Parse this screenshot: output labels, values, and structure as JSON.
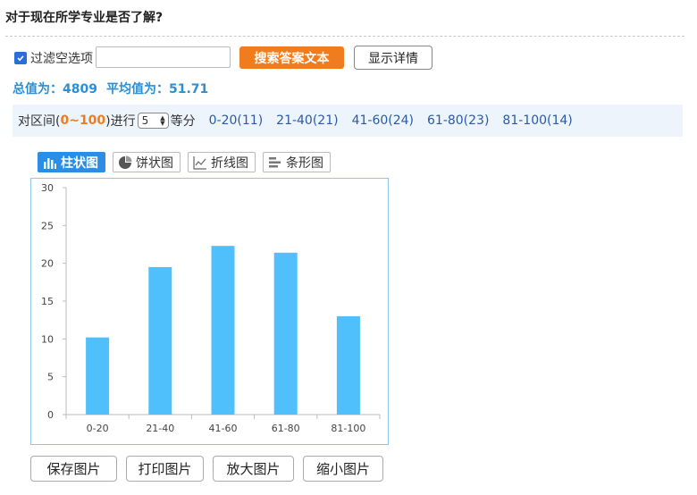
{
  "question": "对于现在所学专业是否了解?",
  "filter": {
    "checked": true,
    "label": "过滤空选项",
    "input_value": "",
    "search_button": "搜索答案文本",
    "detail_button": "显示详情"
  },
  "stats": {
    "total": "总值为：4809",
    "average": "平均值为：51.71"
  },
  "range": {
    "prefix": "对区间(",
    "range_text": "0~100",
    "suffix": ")进行",
    "select_value": "5",
    "after": "等分",
    "links": [
      "0-20(11)",
      "21-40(21)",
      "41-60(24)",
      "61-80(23)",
      "81-100(14)"
    ]
  },
  "chart_tabs": [
    {
      "label": "柱状图",
      "icon": "bar-chart-icon",
      "active": true
    },
    {
      "label": "饼状图",
      "icon": "pie-chart-icon",
      "active": false
    },
    {
      "label": "折线图",
      "icon": "line-chart-icon",
      "active": false
    },
    {
      "label": "条形图",
      "icon": "bar-horizontal-icon",
      "active": false
    }
  ],
  "chart_data": {
    "type": "bar",
    "categories": [
      "0-20",
      "21-40",
      "41-60",
      "61-80",
      "81-100"
    ],
    "values": [
      10.2,
      19.5,
      22.3,
      21.4,
      13.0
    ],
    "yticks": [
      0,
      5,
      10,
      15,
      20,
      25,
      30
    ],
    "ylim": [
      0,
      30
    ],
    "bar_color": "#4fc0fb",
    "grid": false
  },
  "bottom_buttons": [
    "保存图片",
    "打印图片",
    "放大图片",
    "缩小图片"
  ],
  "colors": {
    "accent_orange": "#f07c1e",
    "stats_blue": "#2a8fd6",
    "link_blue": "#2a5aa8",
    "tab_active": "#2a8ee6"
  }
}
